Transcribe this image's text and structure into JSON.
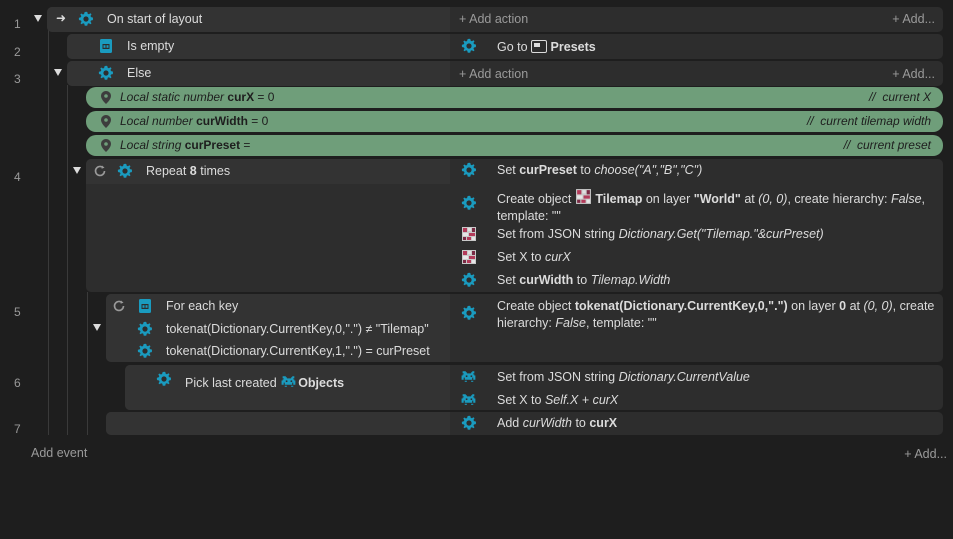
{
  "line_numbers": [
    "1",
    "2",
    "3",
    "4",
    "5",
    "6",
    "7"
  ],
  "colors": {
    "background": "#1e1e1e",
    "block": "#2d2d2d",
    "local_var": "#6f9e7a",
    "icon_teal": "#1a9bbf",
    "text": "#dcdcdc",
    "muted": "#9a9a9a"
  },
  "event1": {
    "condition": "On start of layout",
    "add_action": "Add action",
    "add": "Add..."
  },
  "event2": {
    "condition": "Is empty",
    "action_prefix": "Go to",
    "action_target": "Presets"
  },
  "event3": {
    "condition": "Else",
    "add_action": "Add action",
    "add": "Add..."
  },
  "locals": [
    {
      "prefix": "Local static number",
      "name": "curX",
      "value": " = 0",
      "comment": "current X"
    },
    {
      "prefix": "Local number",
      "name": "curWidth",
      "value": " = 0",
      "comment": "current tilemap width"
    },
    {
      "prefix": "Local string",
      "name": "curPreset",
      "value": " = ",
      "comment": "current preset"
    }
  ],
  "comment_marker": "//",
  "event4": {
    "repeat_prefix": "Repeat",
    "repeat_count": "8",
    "repeat_suffix": "times",
    "actions": {
      "a1_set": "Set",
      "a1_var": "curPreset",
      "a1_to": "to",
      "a1_expr": "choose(\"A\",\"B\",\"C\")",
      "a2_prefix": "Create object",
      "a2_obj": "Tilemap",
      "a2_on": "on layer",
      "a2_layer": "\"World\"",
      "a2_at": "at",
      "a2_pos": "(0, 0)",
      "a2_hier": ", create hierarchy:",
      "a2_false": "False",
      "a2_tpl": "template: \"\"",
      "a3_prefix": "Set from JSON string",
      "a3_expr": "Dictionary.Get(\"Tilemap.\"&curPreset)",
      "a4_prefix": "Set X to",
      "a4_expr": "curX",
      "a5_set": "Set",
      "a5_var": "curWidth",
      "a5_to": "to",
      "a5_expr": "Tilemap.Width"
    }
  },
  "event5": {
    "for_each": "For each key",
    "cond1": "tokenat(Dictionary.CurrentKey,0,\".\") ≠ \"Tilemap\"",
    "cond2": "tokenat(Dictionary.CurrentKey,1,\".\") = curPreset",
    "action_prefix": "Create object",
    "action_obj": "tokenat(Dictionary.CurrentKey,0,\".\")",
    "action_on": "on layer",
    "action_layer": "0",
    "action_at": "at",
    "action_pos": "(0, 0)",
    "action_line2_a": "create hierarchy:",
    "action_false": "False",
    "action_line2_b": ", template: \"\""
  },
  "event6": {
    "condition_prefix": "Pick last created",
    "condition_obj": "Objects",
    "a1_prefix": "Set from JSON string",
    "a1_expr": "Dictionary.CurrentValue",
    "a2_prefix": "Set X to",
    "a2_expr": "Self.X + curX"
  },
  "event7": {
    "add": "Add",
    "var": "curWidth",
    "to": "to",
    "target": "curX"
  },
  "footer": {
    "add_event": "Add event",
    "add": "Add..."
  }
}
